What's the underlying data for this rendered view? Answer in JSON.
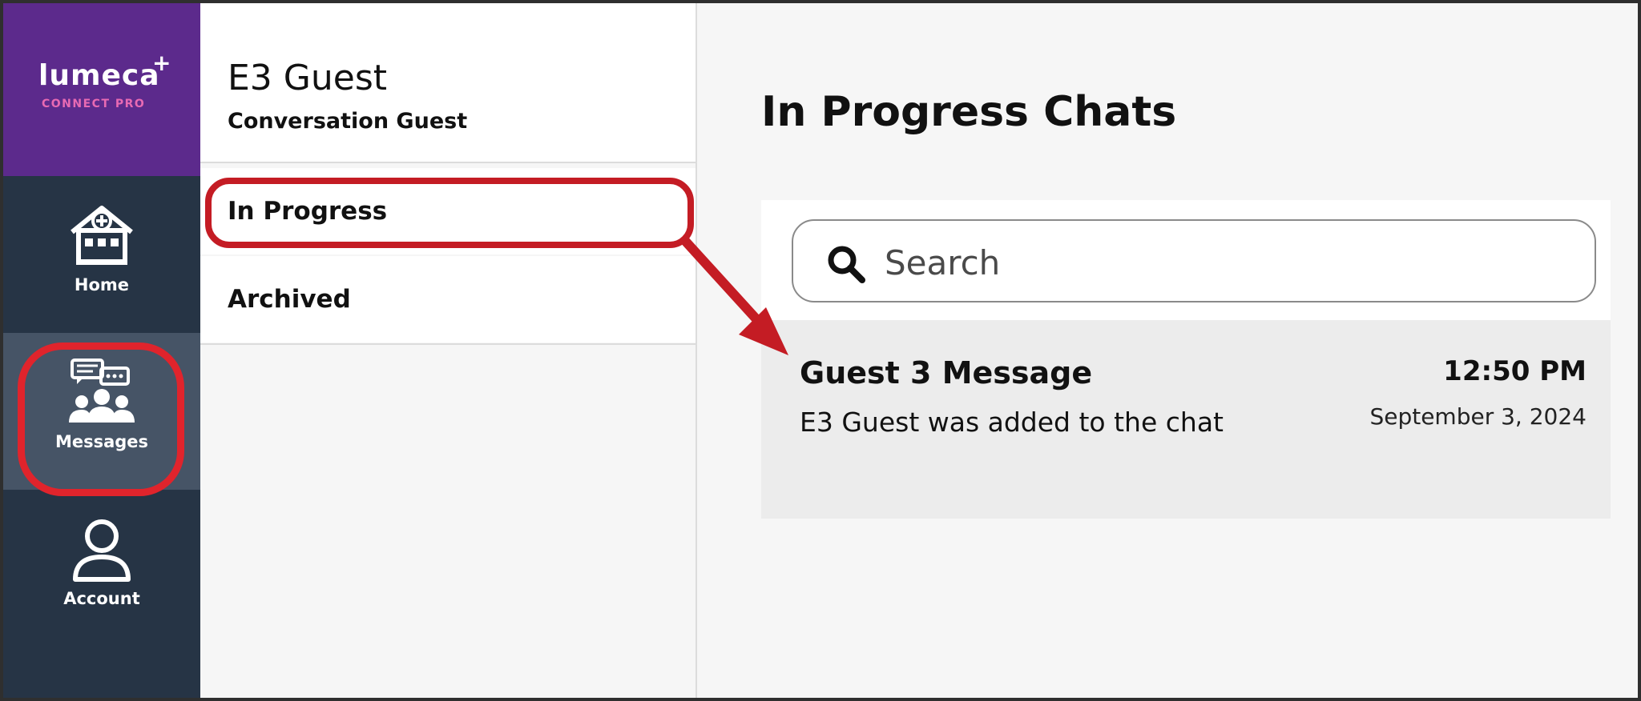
{
  "brand": {
    "name": "lumeca",
    "plus": "+",
    "subtitle": "CONNECT PRO"
  },
  "rail": {
    "items": [
      {
        "label": "Home",
        "icon": "home-clinic-icon",
        "active": false
      },
      {
        "label": "Messages",
        "icon": "messages-group-icon",
        "active": true
      },
      {
        "label": "Account",
        "icon": "account-person-icon",
        "active": false
      }
    ]
  },
  "user": {
    "name": "E3 Guest",
    "role": "Conversation Guest"
  },
  "nav": {
    "items": [
      {
        "label": "In Progress",
        "selected": true
      },
      {
        "label": "Archived",
        "selected": false
      }
    ]
  },
  "main": {
    "title": "In Progress Chats",
    "search": {
      "placeholder": "Search",
      "value": ""
    }
  },
  "conversations": [
    {
      "title": "Guest 3 Message",
      "preview": "E3 Guest was added to the chat",
      "time": "12:50 PM",
      "date": "September 3, 2024"
    }
  ],
  "colors": {
    "rail": "#263445",
    "rail_active": "#465466",
    "brand": "#5c2a8c",
    "brand_sub": "#e86ab3",
    "annotation": "#d0202a"
  }
}
